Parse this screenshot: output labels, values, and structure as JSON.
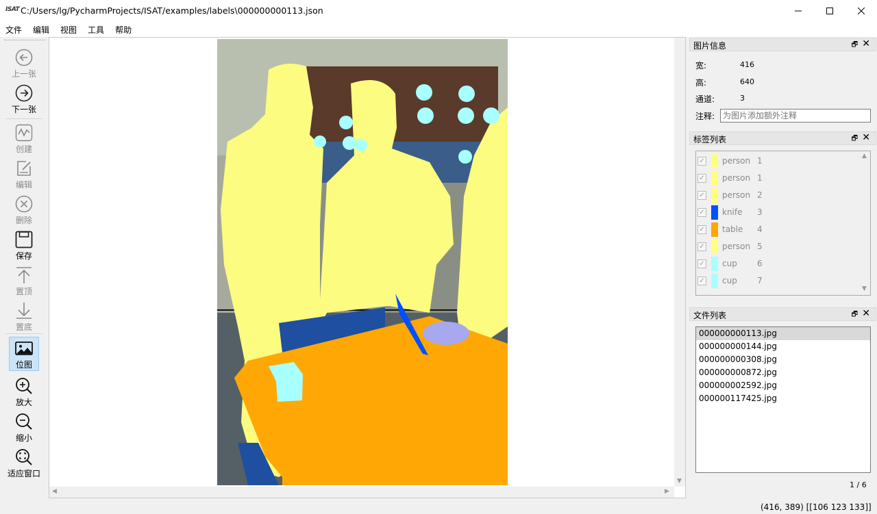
{
  "window": {
    "app_icon": "ISAT",
    "title": "C:/Users/lg/PycharmProjects/ISAT/examples/labels\\000000000113.json",
    "minimize": "—",
    "maximize": "☐",
    "close": "✕"
  },
  "menu": [
    "文件",
    "编辑",
    "视图",
    "工具",
    "帮助"
  ],
  "toolbar": {
    "prev": "上一张",
    "next": "下一张",
    "create": "创建",
    "edit": "编辑",
    "delete": "删除",
    "save": "保存",
    "to_top": "置顶",
    "to_bottom": "置底",
    "bitmap": "位图",
    "zoom_in": "放大",
    "zoom_out": "缩小",
    "fit_window": "适应窗口"
  },
  "image_info": {
    "title": "图片信息",
    "width_label": "宽:",
    "width_value": "416",
    "height_label": "高:",
    "height_value": "640",
    "channels_label": "通道:",
    "channels_value": "3",
    "note_label": "注释:",
    "note_placeholder": "为图片添加额外注释"
  },
  "label_list": {
    "title": "标签列表",
    "items": [
      {
        "name": "person",
        "group": "1",
        "color": "#ffff80"
      },
      {
        "name": "person",
        "group": "1",
        "color": "#ffff80"
      },
      {
        "name": "person",
        "group": "2",
        "color": "#ffff80"
      },
      {
        "name": "knife",
        "group": "3",
        "color": "#0050ff"
      },
      {
        "name": "table",
        "group": "4",
        "color": "#ffa500"
      },
      {
        "name": "person",
        "group": "5",
        "color": "#ffff80"
      },
      {
        "name": "cup",
        "group": "6",
        "color": "#a8ffff"
      },
      {
        "name": "cup",
        "group": "7",
        "color": "#a8ffff"
      }
    ]
  },
  "file_list": {
    "title": "文件列表",
    "files": [
      "000000000113.jpg",
      "000000000144.jpg",
      "000000000308.jpg",
      "000000000872.jpg",
      "000000002592.jpg",
      "000000117425.jpg"
    ],
    "selected": "000000000113.jpg",
    "counter": "1 / 6"
  },
  "status": "(416, 389) [[106 123 133]]",
  "dock_controls": {
    "float": "🗗",
    "close": "✕"
  }
}
